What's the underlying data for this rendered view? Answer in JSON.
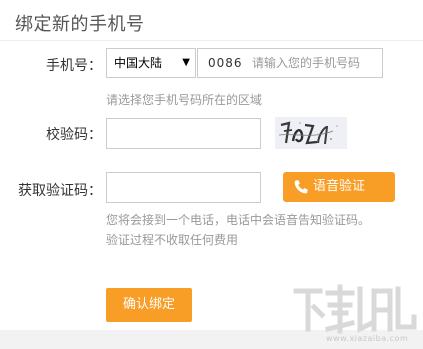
{
  "page": {
    "title": "绑定新的手机号"
  },
  "phone": {
    "label": "手机号：",
    "region_selected": "中国大陆",
    "country_code": "0086",
    "placeholder": "请输入您的手机号码",
    "region_hint": "请选择您手机号码所在的区域"
  },
  "captcha": {
    "label": "校验码："
  },
  "verify_code": {
    "label": "获取验证码：",
    "voice_button": "语音验证",
    "help_line_1": "您将会接到一个电话，电话中会语音告知验证码。",
    "help_line_2": "验证过程不收取任何费用"
  },
  "actions": {
    "confirm": "确认绑定"
  },
  "watermark": {
    "url": "www.xiazaiba.com"
  },
  "colors": {
    "accent": "#f89d25",
    "hint": "#999999",
    "border": "#cccccc"
  }
}
